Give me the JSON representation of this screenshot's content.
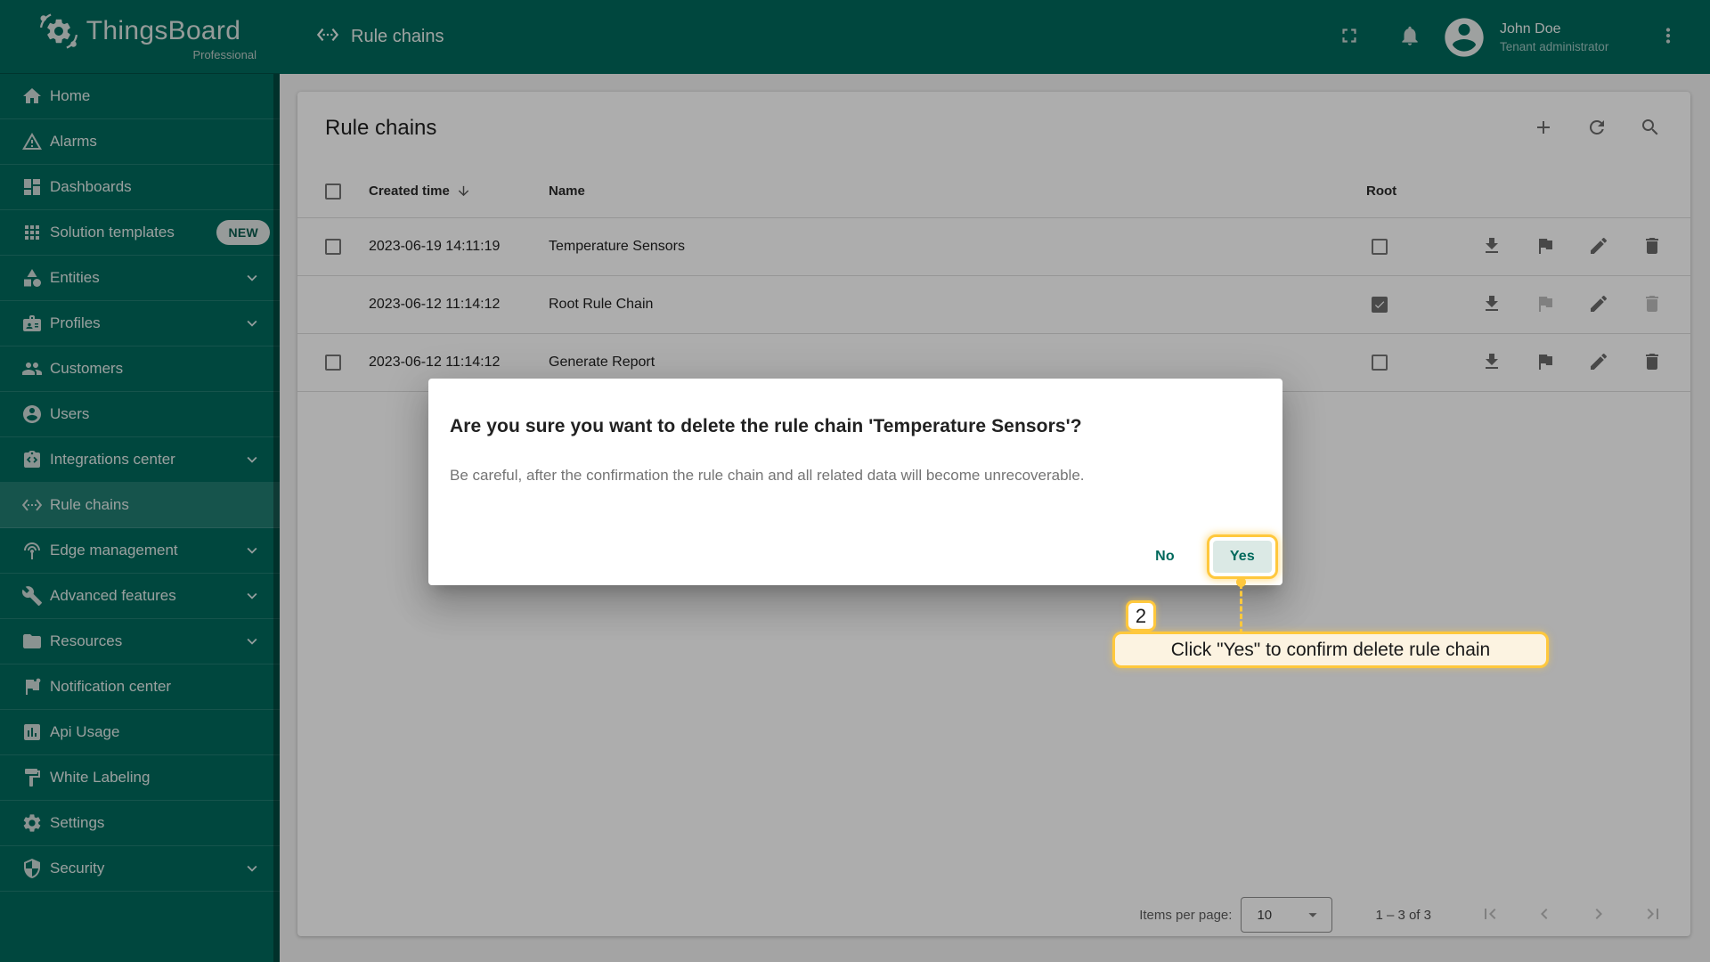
{
  "app": {
    "brand": "ThingsBoard",
    "brand_sub": "Professional"
  },
  "colors": {
    "primary": "#00695C",
    "annotation_yellow": "#FFC83D",
    "tooltip_bg": "#FCF3E1",
    "yes_button_bg": "#DBE9E5",
    "backdrop": "rgba(0,0,0,0.32)"
  },
  "sidebar": {
    "items": [
      {
        "label": "Home",
        "icon": "home-icon"
      },
      {
        "label": "Alarms",
        "icon": "alarm-warning-icon"
      },
      {
        "label": "Dashboards",
        "icon": "dashboards-icon"
      },
      {
        "label": "Solution templates",
        "icon": "solution-templates-icon",
        "badge": "NEW"
      },
      {
        "label": "Entities",
        "icon": "entities-icon",
        "expandable": true
      },
      {
        "label": "Profiles",
        "icon": "profiles-icon",
        "expandable": true
      },
      {
        "label": "Customers",
        "icon": "customers-icon"
      },
      {
        "label": "Users",
        "icon": "users-icon"
      },
      {
        "label": "Integrations center",
        "icon": "integrations-icon",
        "expandable": true
      },
      {
        "label": "Rule chains",
        "icon": "rule-chains-icon",
        "selected": true
      },
      {
        "label": "Edge management",
        "icon": "edge-management-icon",
        "expandable": true
      },
      {
        "label": "Advanced features",
        "icon": "advanced-features-icon",
        "expandable": true
      },
      {
        "label": "Resources",
        "icon": "resources-icon",
        "expandable": true
      },
      {
        "label": "Notification center",
        "icon": "notification-center-icon"
      },
      {
        "label": "Api Usage",
        "icon": "api-usage-icon"
      },
      {
        "label": "White Labeling",
        "icon": "white-labeling-icon"
      },
      {
        "label": "Settings",
        "icon": "settings-icon"
      },
      {
        "label": "Security",
        "icon": "security-icon",
        "expandable": true
      }
    ]
  },
  "topbar": {
    "title": "Rule chains",
    "user": {
      "name": "John Doe",
      "role": "Tenant administrator"
    }
  },
  "table": {
    "title": "Rule chains",
    "columns": {
      "created": "Created time",
      "name": "Name",
      "root": "Root"
    },
    "rows": [
      {
        "created": "2023-06-19 14:11:19",
        "name": "Temperature Sensors",
        "root": false,
        "selectable": true,
        "flag_disabled": false,
        "delete_disabled": false
      },
      {
        "created": "2023-06-12 11:14:12",
        "name": "Root Rule Chain",
        "root": true,
        "selectable": false,
        "flag_disabled": true,
        "delete_disabled": true
      },
      {
        "created": "2023-06-12 11:14:12",
        "name": "Generate Report",
        "root": false,
        "selectable": true,
        "flag_disabled": false,
        "delete_disabled": false
      }
    ]
  },
  "dialog": {
    "title": "Are you sure you want to delete the rule chain 'Temperature Sensors'?",
    "body": "Be careful, after the confirmation the rule chain and all related data will become unrecoverable.",
    "no_label": "No",
    "yes_label": "Yes"
  },
  "annotation": {
    "step": "2",
    "tooltip": "Click \"Yes\" to confirm delete rule chain"
  },
  "paginator": {
    "items_per_page_label": "Items per page:",
    "page_size": "10",
    "range": "1 – 3 of 3"
  }
}
